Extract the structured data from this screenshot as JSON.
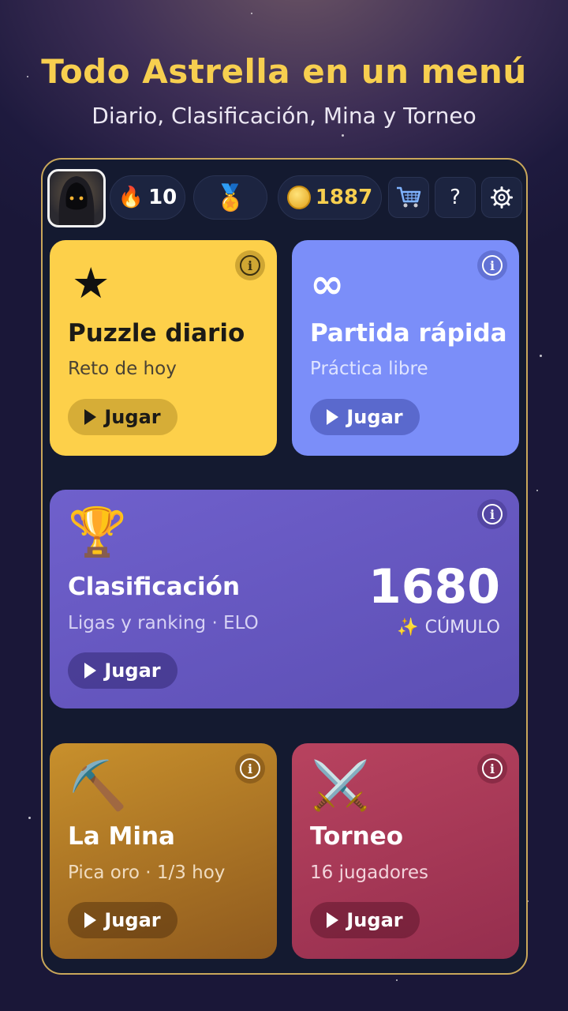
{
  "header": {
    "title": "Todo Astrella en un menú",
    "subtitle": "Diario, Clasificación, Mina y Torneo"
  },
  "top_bar": {
    "avatar_icon": "hooded-figure-avatar",
    "streak": {
      "icon": "flame-icon",
      "value": "10"
    },
    "medal_icon": "medal-icon",
    "coins": {
      "icon": "coin-icon",
      "value": "1887"
    },
    "shop_icon": "cart-icon",
    "help_label": "?",
    "settings_icon": "gear-icon"
  },
  "cards": {
    "daily": {
      "icon": "★",
      "title": "Puzzle diario",
      "subtitle": "Reto de hoy",
      "button": "Jugar",
      "color": "#fdd04a"
    },
    "quick": {
      "icon": "∞",
      "title": "Partida rápida",
      "subtitle": "Práctica libre",
      "button": "Jugar",
      "color": "#7b8ef9"
    },
    "ranking": {
      "icon": "🏆",
      "title": "Clasificación",
      "subtitle": "Ligas y ranking · ELO",
      "button": "Jugar",
      "score": "1680",
      "score_icon": "✨",
      "score_label": "CÚMULO",
      "color": "#6b5cc4"
    },
    "mine": {
      "icon": "⛏️",
      "title": "La Mina",
      "subtitle": "Pica oro · 1/3 hoy",
      "button": "Jugar",
      "color": "#b77b24"
    },
    "tournament": {
      "icon": "⚔️",
      "title": "Torneo",
      "subtitle": "16 jugadores",
      "button": "Jugar",
      "color": "#b0405e"
    }
  },
  "info_label": "i"
}
